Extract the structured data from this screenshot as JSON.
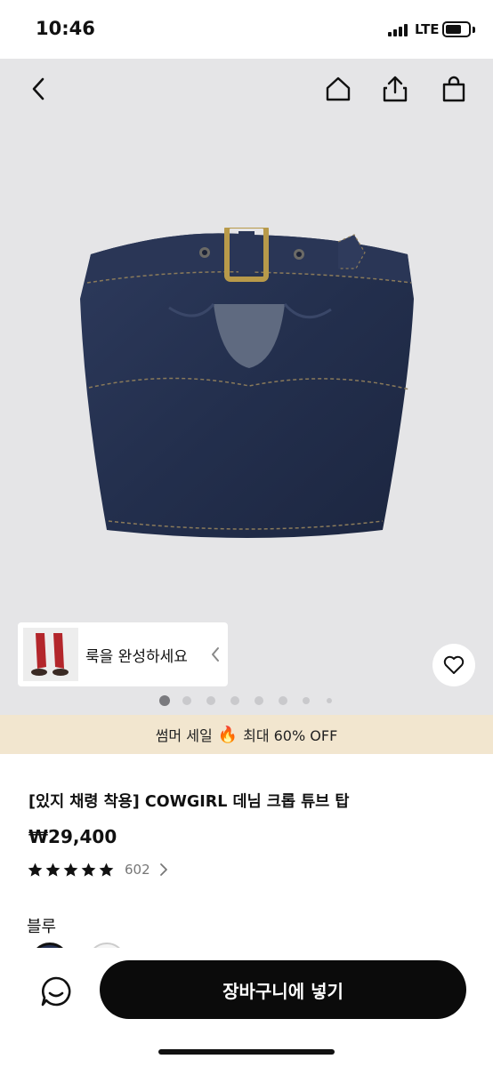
{
  "status": {
    "time": "10:46",
    "network": "LTE",
    "battery_level": 0.7
  },
  "header": {
    "back_icon": "chevron-left-icon",
    "home_icon": "home-icon",
    "share_icon": "share-icon",
    "bag_icon": "shopping-bag-icon"
  },
  "look": {
    "label": "룩을 완성하세요"
  },
  "carousel": {
    "total": 8,
    "active_index": 0
  },
  "promo": {
    "text_before": "썸머 세일",
    "icon": "fire-icon",
    "text_after": "최대 60% OFF"
  },
  "product": {
    "title": "[있지 채령 착용] COWGIRL 데님 크롭 튜브 탑",
    "price": "₩29,400",
    "rating": 5,
    "review_count": "602"
  },
  "options": {
    "color_label": "블루"
  },
  "actions": {
    "add_to_cart": "장바구니에 넣기"
  },
  "colors": {
    "accent": "#0b0b0b",
    "promo_bg": "#f2e6cf",
    "hero_bg": "#e5e5e7",
    "denim": "#283556"
  }
}
